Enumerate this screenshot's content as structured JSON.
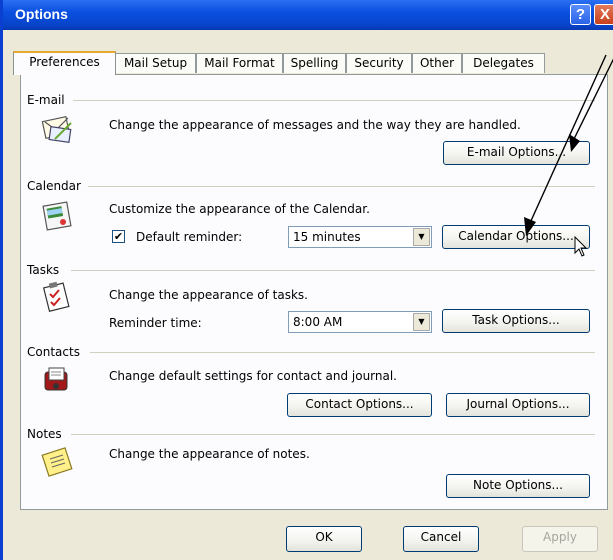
{
  "window": {
    "title": "Options"
  },
  "tabs": [
    "Preferences",
    "Mail Setup",
    "Mail Format",
    "Spelling",
    "Security",
    "Other",
    "Delegates"
  ],
  "email": {
    "label": "E-mail",
    "description": "Change the appearance of messages and the way they are handled.",
    "button": "E-mail Options..."
  },
  "calendar": {
    "label": "Calendar",
    "description": "Customize the appearance of the Calendar.",
    "reminder_label": "Default reminder:",
    "reminder_checked": true,
    "reminder_value": "15 minutes",
    "button": "Calendar Options..."
  },
  "tasks": {
    "label": "Tasks",
    "description": "Change the appearance of tasks.",
    "reminder_label": "Reminder time:",
    "reminder_value": "8:00 AM",
    "button": "Task Options..."
  },
  "contacts": {
    "label": "Contacts",
    "description": "Change default settings for contact and journal.",
    "contact_button": "Contact Options...",
    "journal_button": "Journal Options..."
  },
  "notes": {
    "label": "Notes",
    "description": "Change the appearance of notes.",
    "button": "Note Options..."
  },
  "footer": {
    "ok": "OK",
    "cancel": "Cancel",
    "apply": "Apply"
  },
  "icons": {
    "help": "?",
    "close": "X",
    "check": "✔",
    "dropdown": "▼"
  },
  "colors": {
    "title_bar": "#0a50e0",
    "dialog": "#ece9d8",
    "tab_highlight": "#e6a92f",
    "annotation": "#000000"
  }
}
